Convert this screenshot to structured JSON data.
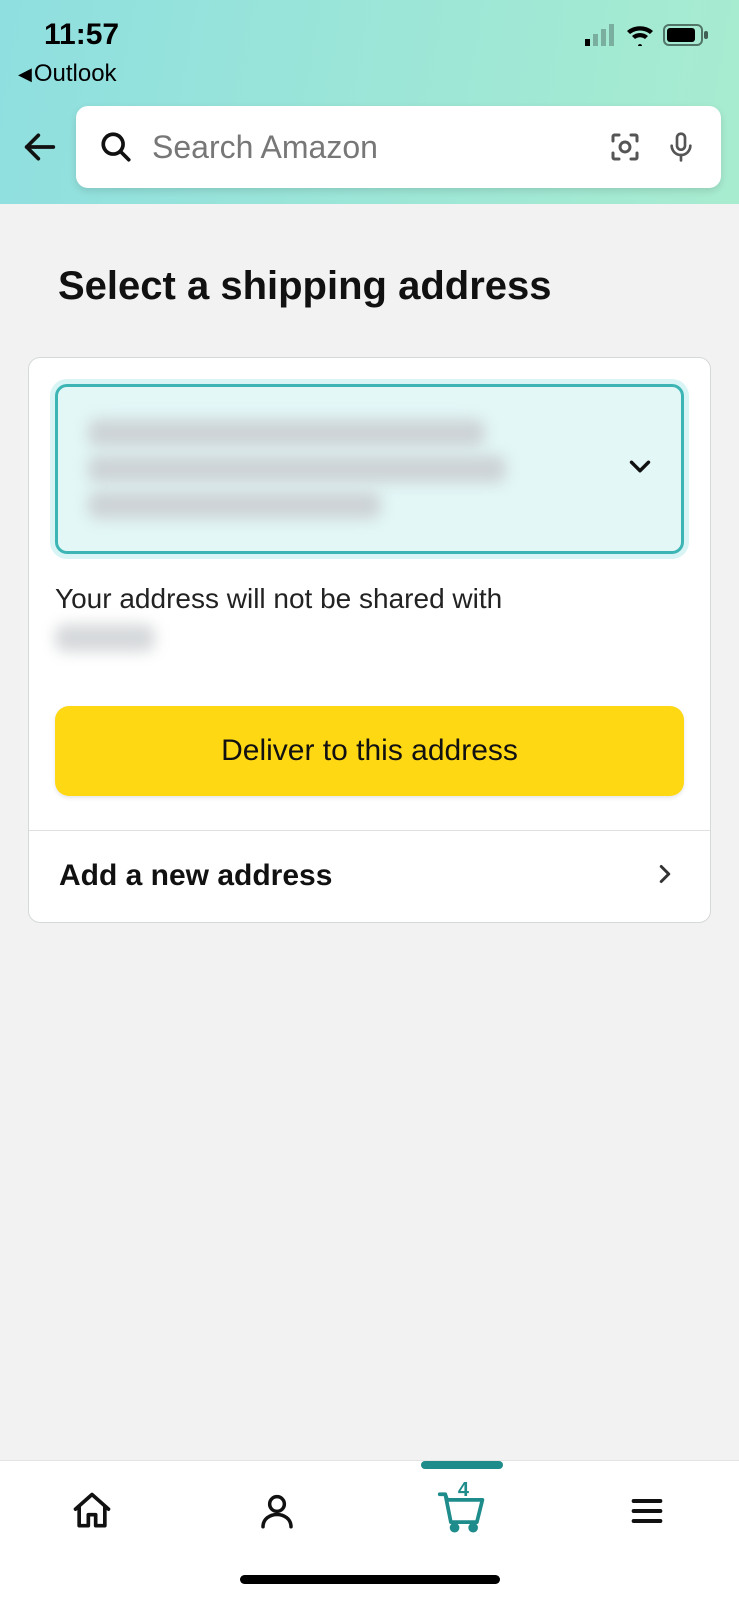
{
  "status": {
    "time": "11:57",
    "back_app_label": "Outlook"
  },
  "search": {
    "placeholder": "Search Amazon"
  },
  "page": {
    "title": "Select a shipping address",
    "hint_prefix": "Your address will not be shared with",
    "deliver_button": "Deliver to this address",
    "add_new_label": "Add a new address"
  },
  "bottom": {
    "cart_count": "4"
  }
}
